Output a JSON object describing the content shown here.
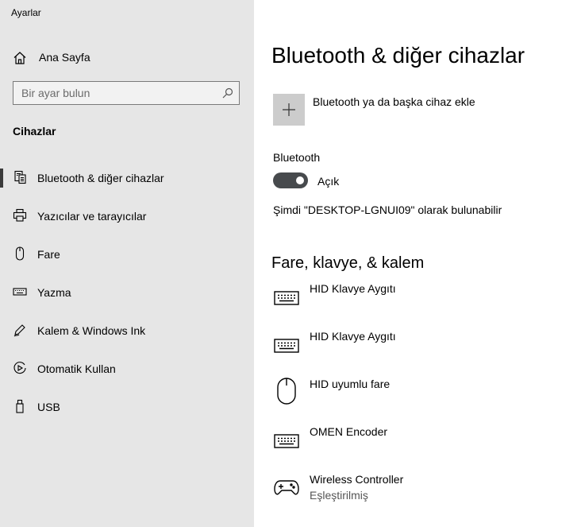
{
  "app": {
    "title": "Ayarlar"
  },
  "sidebar": {
    "home_label": "Ana Sayfa",
    "search_placeholder": "Bir ayar bulun",
    "section_title": "Cihazlar",
    "items": [
      {
        "label": "Bluetooth & diğer cihazlar",
        "icon": "bluetooth-devices-icon",
        "active": true
      },
      {
        "label": "Yazıcılar ve tarayıcılar",
        "icon": "printer-icon"
      },
      {
        "label": "Fare",
        "icon": "mouse-icon"
      },
      {
        "label": "Yazma",
        "icon": "keyboard-icon"
      },
      {
        "label": "Kalem & Windows Ink",
        "icon": "pen-icon"
      },
      {
        "label": "Otomatik Kullan",
        "icon": "autoplay-icon"
      },
      {
        "label": "USB",
        "icon": "usb-icon"
      }
    ]
  },
  "main": {
    "title": "Bluetooth & diğer cihazlar",
    "add_device_label": "Bluetooth ya da başka cihaz ekle",
    "bluetooth_label": "Bluetooth",
    "bluetooth_state": "Açık",
    "bluetooth_on": true,
    "discoverable_text": "Şimdi \"DESKTOP-LGNUI09\" olarak bulunabilir",
    "devices_section_title": "Fare, klavye, & kalem",
    "devices": [
      {
        "name": "HID Klavye Aygıtı",
        "icon": "keyboard-icon"
      },
      {
        "name": "HID Klavye Aygıtı",
        "icon": "keyboard-icon"
      },
      {
        "name": "HID uyumlu fare",
        "icon": "mouse-icon"
      },
      {
        "name": "OMEN Encoder",
        "icon": "keyboard-icon"
      },
      {
        "name": "Wireless Controller",
        "icon": "gamepad-icon",
        "status": "Eşleştirilmiş"
      }
    ]
  },
  "colors": {
    "sidebar_bg": "#e6e6e6",
    "toggle_on": "#474a4d",
    "tile_bg": "#cccccc"
  }
}
